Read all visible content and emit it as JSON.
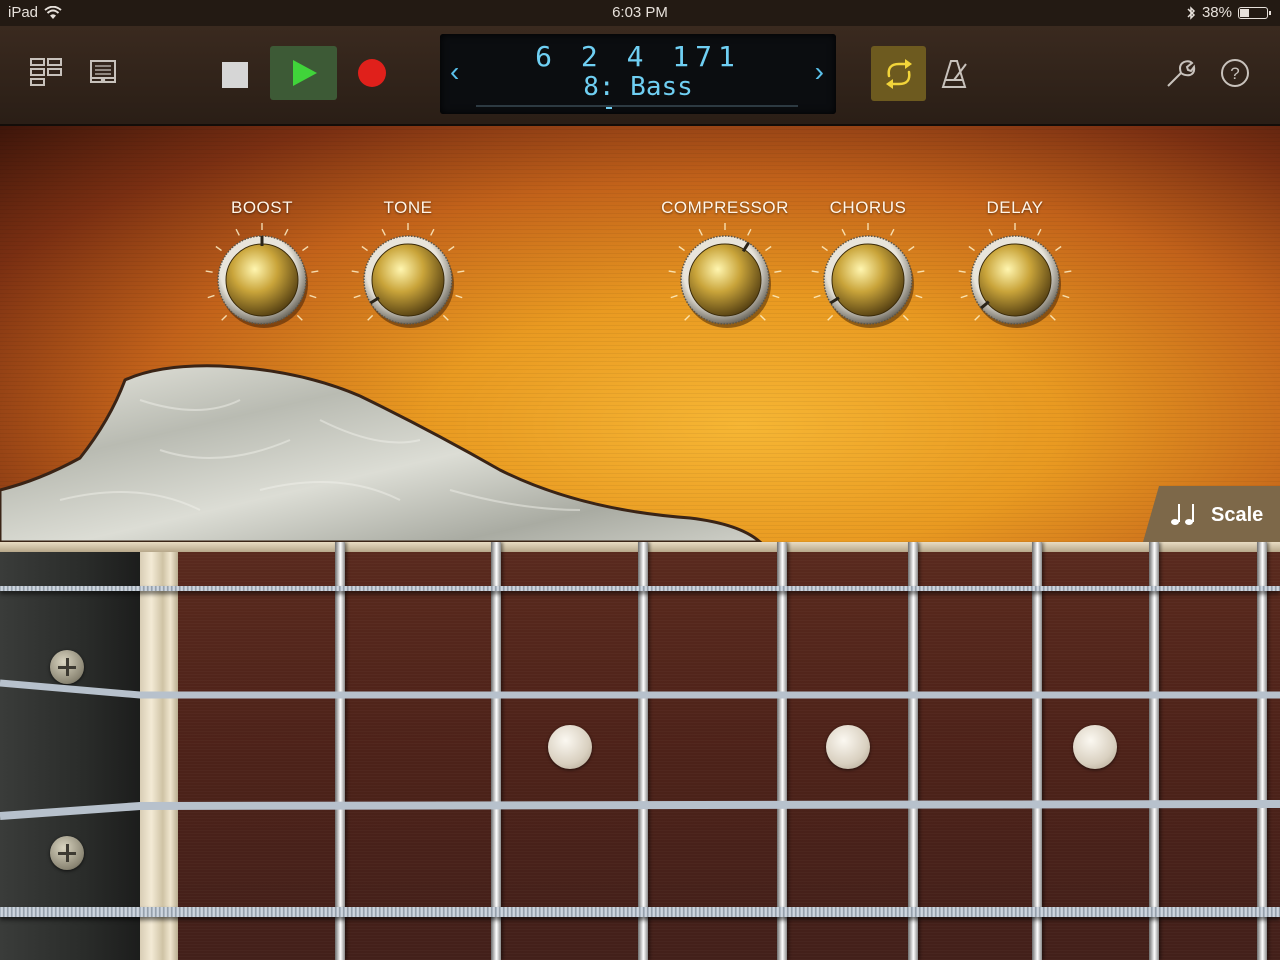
{
  "status_bar": {
    "device": "iPad",
    "time": "6:03 PM",
    "battery_percent_text": "38%",
    "battery_level": 0.38
  },
  "toolbar": {
    "lcd": {
      "position": "6 2 4 171",
      "track": "8: Bass",
      "prev": "‹",
      "next": "›"
    },
    "icons": {
      "tracks_view": "tracks-view-icon",
      "mixer": "instrument-browser-icon",
      "stop": "stop-icon",
      "play": "play-icon",
      "record": "record-icon",
      "cycle": "cycle-icon",
      "metronome": "metronome-icon",
      "settings": "wrench-icon",
      "help": "help-icon"
    }
  },
  "knobs": [
    {
      "label": "BOOST",
      "level": 0.5
    },
    {
      "label": "TONE",
      "level": 0.05
    },
    {
      "label": "COMPRESSOR",
      "level": 0.62
    },
    {
      "label": "CHORUS",
      "level": 0.05
    },
    {
      "label": "DELAY",
      "level": 0.02
    }
  ],
  "scale_button": {
    "label": "Scale",
    "icon": "music-notes-icon"
  },
  "colors": {
    "lcd_text": "#6fcff3",
    "play_bg": "#3d5a36",
    "record": "#e0201b",
    "cycle_active": "#6d5a1f",
    "cycle_icon": "#f2d43a"
  }
}
